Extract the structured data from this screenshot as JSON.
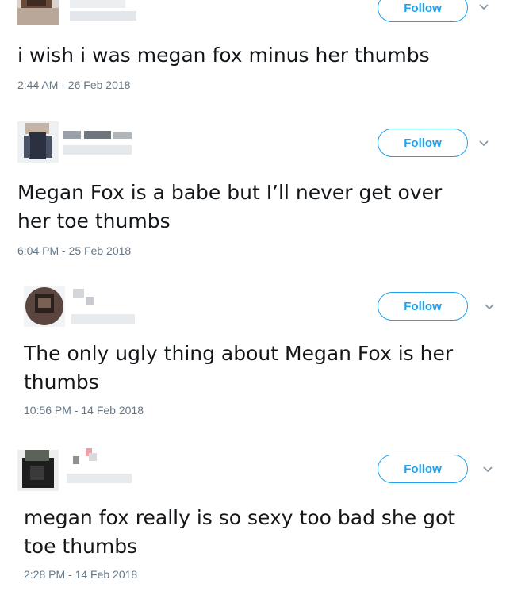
{
  "tweets": [
    {
      "follow_label": "Follow",
      "text": "i wish i was megan fox minus her thumbs",
      "timestamp": "2:44 AM - 26 Feb 2018"
    },
    {
      "follow_label": "Follow",
      "text": "Megan Fox is a babe but I’ll never get over her toe thumbs",
      "timestamp": "6:04 PM - 25 Feb 2018"
    },
    {
      "follow_label": "Follow",
      "text": "The only ugly thing about Megan Fox is her thumbs",
      "timestamp": "10:56 PM - 14 Feb 2018"
    },
    {
      "follow_label": "Follow",
      "text": "megan fox really is so sexy too bad she got toe thumbs",
      "timestamp": "2:28 PM - 14 Feb 2018"
    }
  ],
  "colors": {
    "accent": "#1da1f2",
    "text": "#14171a",
    "muted": "#657786"
  },
  "icons": {
    "caret": "chevron-down-icon",
    "avatar": "pixelated-avatar"
  }
}
